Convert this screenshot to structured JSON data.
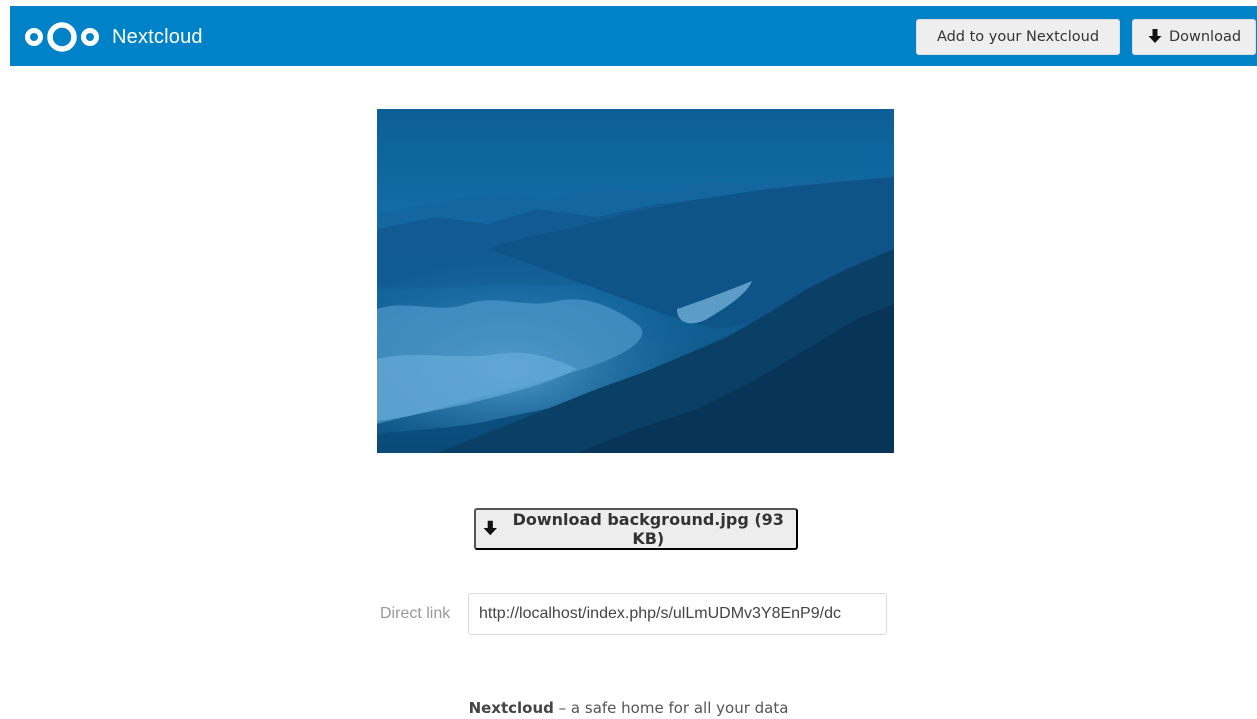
{
  "header": {
    "app_name": "Nextcloud",
    "logo_icon": "nextcloud-logo-icon",
    "add_button_label": "Add to your Nextcloud",
    "download_button_label": "Download",
    "accent_color": "#0082c9"
  },
  "preview": {
    "image_icon": "mountain-clouds-preview-image"
  },
  "main": {
    "download_label": "Download background.jpg (93 KB)",
    "direct_link_label": "Direct link",
    "direct_link_value": "http://localhost/index.php/s/ulLmUDMv3Y8EnP9/dc"
  },
  "footer": {
    "brand": "Nextcloud",
    "tagline": " – a safe home for all your data"
  }
}
